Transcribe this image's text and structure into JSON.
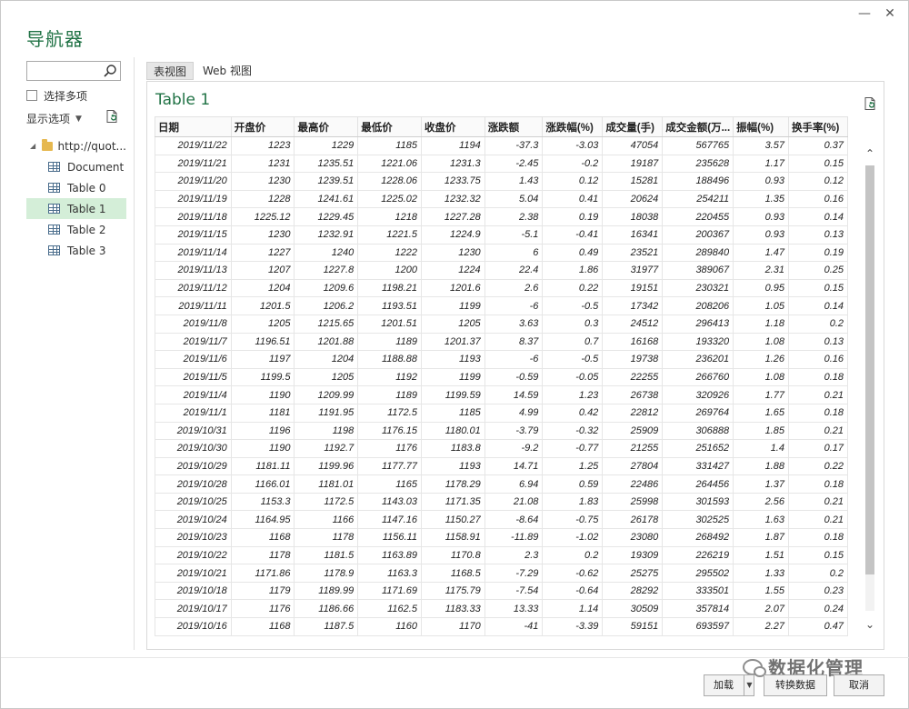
{
  "window": {
    "title": "导航器",
    "minimize_glyph": "—",
    "maximize_glyph": "☐",
    "close_glyph": "✕"
  },
  "sidebar": {
    "search_placeholder": "",
    "multi_select_label": "选择多项",
    "display_options_label": "显示选项",
    "tree": {
      "root_label": "http://quot...",
      "items": [
        {
          "label": "Document",
          "selected": false
        },
        {
          "label": "Table 0",
          "selected": false
        },
        {
          "label": "Table 1",
          "selected": true
        },
        {
          "label": "Table 2",
          "selected": false
        },
        {
          "label": "Table 3",
          "selected": false
        }
      ]
    }
  },
  "tabs": [
    {
      "label": "表视图",
      "active": true
    },
    {
      "label": "Web 视图",
      "active": false
    }
  ],
  "preview": {
    "title": "Table 1",
    "columns": [
      "日期",
      "开盘价",
      "最高价",
      "最低价",
      "收盘价",
      "涨跌额",
      "涨跌幅(%)",
      "成交量(手)",
      "成交金额(万...",
      "振幅(%)",
      "换手率(%)"
    ],
    "rows": [
      [
        "2019/11/22",
        "1223",
        "1229",
        "1185",
        "1194",
        "-37.3",
        "-3.03",
        "47054",
        "567765",
        "3.57",
        "0.37"
      ],
      [
        "2019/11/21",
        "1231",
        "1235.51",
        "1221.06",
        "1231.3",
        "-2.45",
        "-0.2",
        "19187",
        "235628",
        "1.17",
        "0.15"
      ],
      [
        "2019/11/20",
        "1230",
        "1239.51",
        "1228.06",
        "1233.75",
        "1.43",
        "0.12",
        "15281",
        "188496",
        "0.93",
        "0.12"
      ],
      [
        "2019/11/19",
        "1228",
        "1241.61",
        "1225.02",
        "1232.32",
        "5.04",
        "0.41",
        "20624",
        "254211",
        "1.35",
        "0.16"
      ],
      [
        "2019/11/18",
        "1225.12",
        "1229.45",
        "1218",
        "1227.28",
        "2.38",
        "0.19",
        "18038",
        "220455",
        "0.93",
        "0.14"
      ],
      [
        "2019/11/15",
        "1230",
        "1232.91",
        "1221.5",
        "1224.9",
        "-5.1",
        "-0.41",
        "16341",
        "200367",
        "0.93",
        "0.13"
      ],
      [
        "2019/11/14",
        "1227",
        "1240",
        "1222",
        "1230",
        "6",
        "0.49",
        "23521",
        "289840",
        "1.47",
        "0.19"
      ],
      [
        "2019/11/13",
        "1207",
        "1227.8",
        "1200",
        "1224",
        "22.4",
        "1.86",
        "31977",
        "389067",
        "2.31",
        "0.25"
      ],
      [
        "2019/11/12",
        "1204",
        "1209.6",
        "1198.21",
        "1201.6",
        "2.6",
        "0.22",
        "19151",
        "230321",
        "0.95",
        "0.15"
      ],
      [
        "2019/11/11",
        "1201.5",
        "1206.2",
        "1193.51",
        "1199",
        "-6",
        "-0.5",
        "17342",
        "208206",
        "1.05",
        "0.14"
      ],
      [
        "2019/11/8",
        "1205",
        "1215.65",
        "1201.51",
        "1205",
        "3.63",
        "0.3",
        "24512",
        "296413",
        "1.18",
        "0.2"
      ],
      [
        "2019/11/7",
        "1196.51",
        "1201.88",
        "1189",
        "1201.37",
        "8.37",
        "0.7",
        "16168",
        "193320",
        "1.08",
        "0.13"
      ],
      [
        "2019/11/6",
        "1197",
        "1204",
        "1188.88",
        "1193",
        "-6",
        "-0.5",
        "19738",
        "236201",
        "1.26",
        "0.16"
      ],
      [
        "2019/11/5",
        "1199.5",
        "1205",
        "1192",
        "1199",
        "-0.59",
        "-0.05",
        "22255",
        "266760",
        "1.08",
        "0.18"
      ],
      [
        "2019/11/4",
        "1190",
        "1209.99",
        "1189",
        "1199.59",
        "14.59",
        "1.23",
        "26738",
        "320926",
        "1.77",
        "0.21"
      ],
      [
        "2019/11/1",
        "1181",
        "1191.95",
        "1172.5",
        "1185",
        "4.99",
        "0.42",
        "22812",
        "269764",
        "1.65",
        "0.18"
      ],
      [
        "2019/10/31",
        "1196",
        "1198",
        "1176.15",
        "1180.01",
        "-3.79",
        "-0.32",
        "25909",
        "306888",
        "1.85",
        "0.21"
      ],
      [
        "2019/10/30",
        "1190",
        "1192.7",
        "1176",
        "1183.8",
        "-9.2",
        "-0.77",
        "21255",
        "251652",
        "1.4",
        "0.17"
      ],
      [
        "2019/10/29",
        "1181.11",
        "1199.96",
        "1177.77",
        "1193",
        "14.71",
        "1.25",
        "27804",
        "331427",
        "1.88",
        "0.22"
      ],
      [
        "2019/10/28",
        "1166.01",
        "1181.01",
        "1165",
        "1178.29",
        "6.94",
        "0.59",
        "22486",
        "264456",
        "1.37",
        "0.18"
      ],
      [
        "2019/10/25",
        "1153.3",
        "1172.5",
        "1143.03",
        "1171.35",
        "21.08",
        "1.83",
        "25998",
        "301593",
        "2.56",
        "0.21"
      ],
      [
        "2019/10/24",
        "1164.95",
        "1166",
        "1147.16",
        "1150.27",
        "-8.64",
        "-0.75",
        "26178",
        "302525",
        "1.63",
        "0.21"
      ],
      [
        "2019/10/23",
        "1168",
        "1178",
        "1156.11",
        "1158.91",
        "-11.89",
        "-1.02",
        "23080",
        "268492",
        "1.87",
        "0.18"
      ],
      [
        "2019/10/22",
        "1178",
        "1181.5",
        "1163.89",
        "1170.8",
        "2.3",
        "0.2",
        "19309",
        "226219",
        "1.51",
        "0.15"
      ],
      [
        "2019/10/21",
        "1171.86",
        "1178.9",
        "1163.3",
        "1168.5",
        "-7.29",
        "-0.62",
        "25275",
        "295502",
        "1.33",
        "0.2"
      ],
      [
        "2019/10/18",
        "1179",
        "1189.99",
        "1171.69",
        "1175.79",
        "-7.54",
        "-0.64",
        "28292",
        "333501",
        "1.55",
        "0.23"
      ],
      [
        "2019/10/17",
        "1176",
        "1186.66",
        "1162.5",
        "1183.33",
        "13.33",
        "1.14",
        "30509",
        "357814",
        "2.07",
        "0.24"
      ],
      [
        "2019/10/16",
        "1168",
        "1187.5",
        "1160",
        "1170",
        "-41",
        "-3.39",
        "59151",
        "693597",
        "2.27",
        "0.47"
      ]
    ]
  },
  "footer": {
    "load_label": "加载",
    "transform_label": "转换数据",
    "cancel_label": "取消",
    "watermark_text": "数据化管理"
  },
  "colors": {
    "accent": "#217346",
    "selected_bg": "#d4eed8"
  },
  "icons": {
    "search": "search-icon",
    "refresh": "refresh-icon",
    "folder": "folder-icon",
    "table": "table-icon"
  }
}
